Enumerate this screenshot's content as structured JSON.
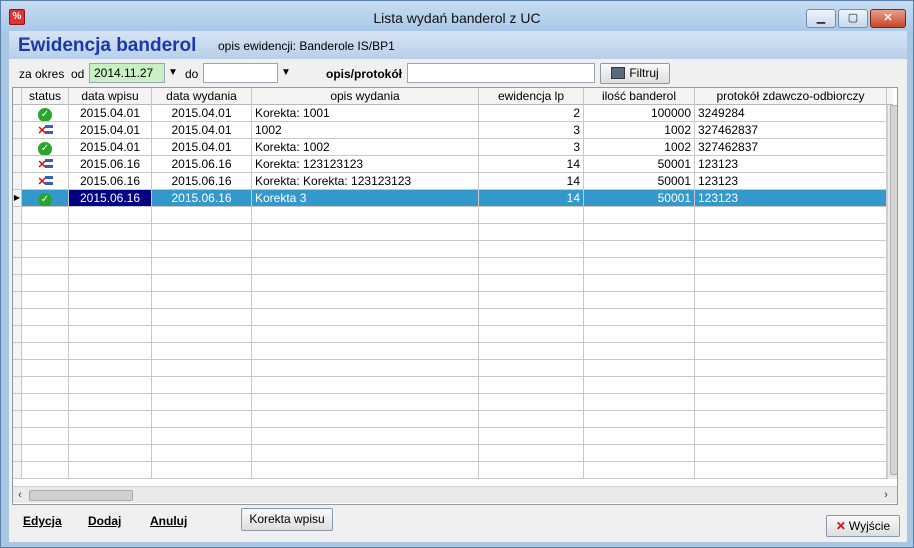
{
  "window": {
    "title": "Lista wydań banderol z UC",
    "app_icon_text": "%",
    "min_label": "▁",
    "max_label": "▢",
    "close_label": "✕"
  },
  "header": {
    "heading": "Ewidencja banderol",
    "opis_ewidencji": "opis ewidencji: Banderole IS/BP1"
  },
  "filter": {
    "za_okres_label": "za okres",
    "od_label": "od",
    "date_from": "2014.11.27",
    "do_label": "do",
    "date_to": "",
    "opis_label": "opis/protokół",
    "opis_value": "",
    "filter_button": "Filtruj"
  },
  "grid": {
    "columns": [
      "status",
      "data wpisu",
      "data wydania",
      "opis wydania",
      "ewidencja lp",
      "ilość banderol",
      "protokół zdawczo-odbiorczy"
    ],
    "rows": [
      {
        "status": "ok",
        "data_wpisu": "2015.04.01",
        "data_wydania": "2015.04.01",
        "opis": "Korekta: 1001",
        "lp": "2",
        "ilosc": "100000",
        "protokol": "3249284"
      },
      {
        "status": "error",
        "data_wpisu": "2015.04.01",
        "data_wydania": "2015.04.01",
        "opis": "1002",
        "lp": "3",
        "ilosc": "1002",
        "protokol": "327462837"
      },
      {
        "status": "ok",
        "data_wpisu": "2015.04.01",
        "data_wydania": "2015.04.01",
        "opis": "Korekta: 1002",
        "lp": "3",
        "ilosc": "1002",
        "protokol": "327462837"
      },
      {
        "status": "error",
        "data_wpisu": "2015.06.16",
        "data_wydania": "2015.06.16",
        "opis": "Korekta: 123123123",
        "lp": "14",
        "ilosc": "50001",
        "protokol": "123123"
      },
      {
        "status": "error",
        "data_wpisu": "2015.06.16",
        "data_wydania": "2015.06.16",
        "opis": "Korekta: Korekta: 123123123",
        "lp": "14",
        "ilosc": "50001",
        "protokol": "123123"
      },
      {
        "status": "ok",
        "data_wpisu": "2015.06.16",
        "data_wydania": "2015.06.16",
        "opis": "Korekta 3",
        "lp": "14",
        "ilosc": "50001",
        "protokol": "123123",
        "selected": true
      }
    ]
  },
  "footer": {
    "edycja": "Edycja",
    "dodaj": "Dodaj",
    "anuluj": "Anuluj",
    "korekta_button": "Korekta wpisu",
    "wyjscie_button": "Wyjście"
  },
  "colors": {
    "heading": "#1a3aa8",
    "selected_row": "#3399cc",
    "selected_focus": "#000080",
    "date_from_bg": "#c9f0c4"
  }
}
